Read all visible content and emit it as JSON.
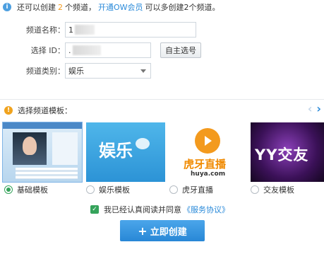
{
  "notice": {
    "prefix": "还可以创建",
    "count": "2",
    "unit": "个频道，",
    "link": "开通OW会员",
    "suffix": "可以多创建2个频道。"
  },
  "form": {
    "name_label": "频道名称：",
    "name_prefix": "1",
    "id_label": "选择 ID：",
    "id_prefix": ".",
    "self_select": "自主选号",
    "category_label": "频道类别：",
    "category_value": "娱乐"
  },
  "templates": {
    "header": "选择频道模板：",
    "items": [
      {
        "label": "基础模板",
        "selected": true
      },
      {
        "label": "娱乐模板",
        "selected": false,
        "image_text": "娱乐"
      },
      {
        "label": "虎牙直播",
        "selected": false,
        "image_text": "虎牙直播",
        "image_subtext": "huya.com"
      },
      {
        "label": "交友模板",
        "selected": false,
        "image_text": "YY交友"
      }
    ]
  },
  "agreement": {
    "text": "我已经认真阅读并同意",
    "link": "《服务协议》",
    "checked": true
  },
  "create_button": {
    "label": "立即创建"
  },
  "colors": {
    "accent": "#2a8ad9",
    "success": "#35a35b",
    "warning": "#f0a31e"
  }
}
